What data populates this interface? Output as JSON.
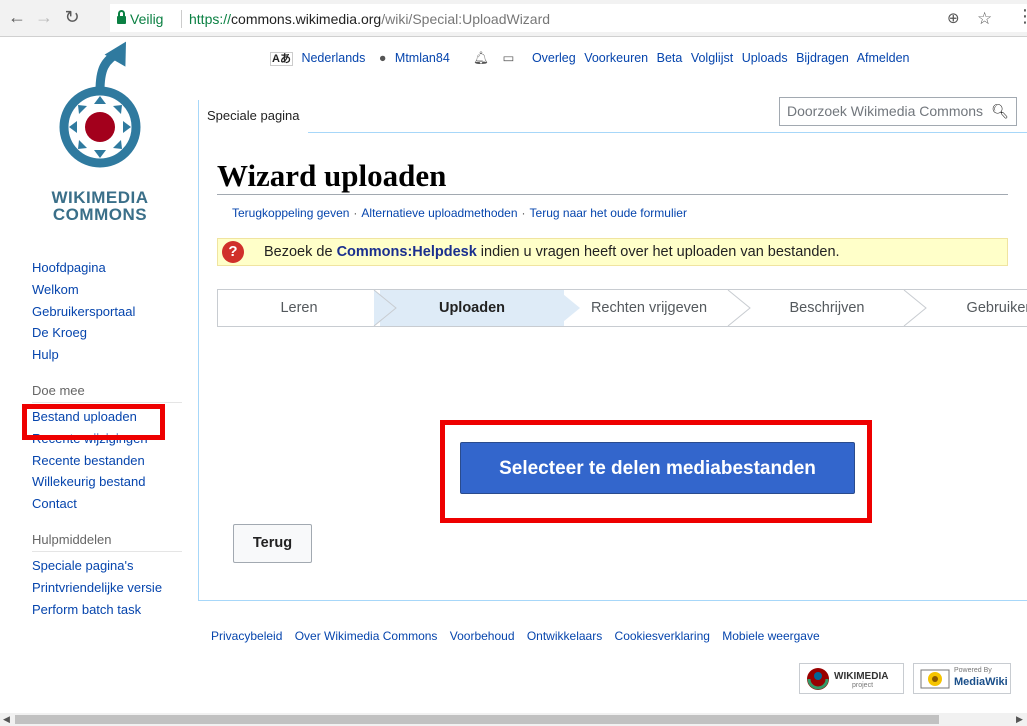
{
  "browser": {
    "secure_label": "Veilig",
    "url_scheme": "https://",
    "url_host": "commons.wikimedia.org",
    "url_path": "/wiki/Special:UploadWizard"
  },
  "logo": {
    "line1": "WIKIMEDIA",
    "line2": "COMMONS"
  },
  "sidebar": {
    "nav": [
      "Hoofdpagina",
      "Welkom",
      "Gebruikersportaal",
      "De Kroeg",
      "Hulp"
    ],
    "participate_heading": "Doe mee",
    "participate": [
      "Bestand uploaden",
      "Recente wijzigingen",
      "Recente bestanden",
      "Willekeurig bestand",
      "Contact"
    ],
    "tools_heading": "Hulpmiddelen",
    "tools": [
      "Speciale pagina's",
      "Printvriendelijke versie",
      "Perform batch task"
    ]
  },
  "personal": {
    "language": "Nederlands",
    "username": "Mtmlan84",
    "links": [
      "Overleg",
      "Voorkeuren",
      "Beta",
      "Volglijst",
      "Uploads",
      "Bijdragen",
      "Afmelden"
    ]
  },
  "tabs": {
    "special": "Speciale pagina"
  },
  "search": {
    "placeholder": "Doorzoek Wikimedia Commons"
  },
  "page": {
    "title": "Wizard uploaden",
    "subnav": [
      "Terugkoppeling geven",
      "Alternatieve uploadmethoden",
      "Terug naar het oude formulier"
    ],
    "notice_prefix": "Bezoek de ",
    "notice_link": "Commons:Helpdesk",
    "notice_suffix": " indien u vragen heeft over het uploaden van bestanden.",
    "steps": [
      "Leren",
      "Uploaden",
      "Rechten vrijgeven",
      "Beschrijven",
      "Gebruiken"
    ],
    "active_step": "Uploaden",
    "select_button": "Selecteer te delen mediabestanden",
    "back_button": "Terug"
  },
  "footer": {
    "links": [
      "Privacybeleid",
      "Over Wikimedia Commons",
      "Voorbehoud",
      "Ontwikkelaars",
      "Cookiesverklaring",
      "Mobiele weergave"
    ],
    "badge_wikimedia": "WIKIMEDIA",
    "badge_wikimedia_sub": "project",
    "badge_mediawiki": "MediaWiki",
    "badge_mediawiki_sub": "Powered By"
  },
  "colors": {
    "highlight": "#ee0000",
    "primary_button": "#3366cc",
    "link": "#0645ad"
  }
}
